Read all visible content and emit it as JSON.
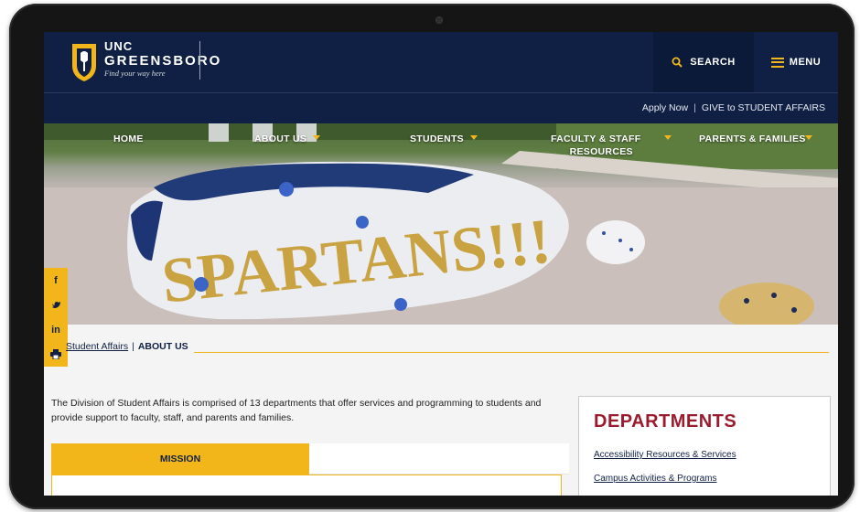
{
  "header": {
    "logo_line1": "UNC",
    "logo_line2": "GREENSBORO",
    "tagline": "Find your way here",
    "search_label": "SEARCH",
    "menu_label": "MENU"
  },
  "utility": {
    "apply": "Apply Now",
    "separator": "|",
    "give": "GIVE to STUDENT AFFAIRS"
  },
  "nav": {
    "home": "HOME",
    "about": "ABOUT US",
    "students": "STUDENTS",
    "faculty_line1": "FACULTY & STAFF",
    "faculty_line2": "RESOURCES",
    "parents": "PARENTS & FAMILIES"
  },
  "hero": {
    "rock_text": "SPARTANS!!!"
  },
  "social": [
    "f",
    "t",
    "in",
    "print"
  ],
  "breadcrumb": {
    "parent": "Student Affairs",
    "separator": "|",
    "current": "ABOUT US"
  },
  "intro": "The Division of Student Affairs is comprised of 13 departments that offer services and programming to students and provide support to faculty, staff, and parents and families.",
  "tabs": {
    "mission": "MISSION"
  },
  "departments": {
    "title": "DEPARTMENTS",
    "links": [
      "Accessibility Resources & Services",
      "Campus Activities & Programs"
    ]
  },
  "colors": {
    "navy": "#0f2044",
    "gold": "#f2b61b",
    "maroon": "#9b1b2e"
  }
}
